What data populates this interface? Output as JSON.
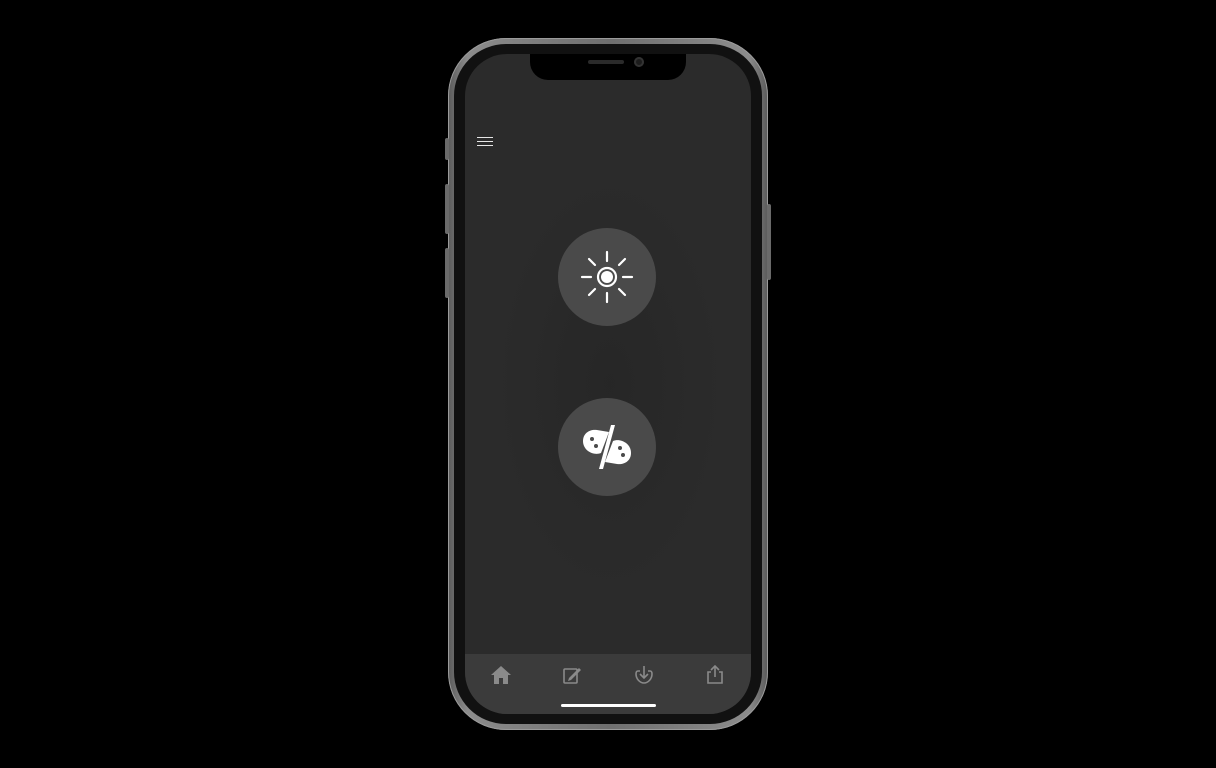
{
  "app": {
    "theme": "dark"
  },
  "colors": {
    "background": "#000000",
    "screen": "#2b2b2b",
    "button": "#4a4a4a",
    "tabbar": "#3b3b3b",
    "icon": "#ffffff",
    "tab_icon": "#8a8a8a"
  },
  "header": {
    "menu_icon": "hamburger-menu-icon"
  },
  "main": {
    "buttons": [
      {
        "icon": "brightness-sun-icon"
      },
      {
        "icon": "swap-shapes-icon"
      }
    ]
  },
  "tabbar": {
    "items": [
      {
        "icon": "home-icon"
      },
      {
        "icon": "edit-icon"
      },
      {
        "icon": "download-icon"
      },
      {
        "icon": "share-icon"
      }
    ]
  }
}
